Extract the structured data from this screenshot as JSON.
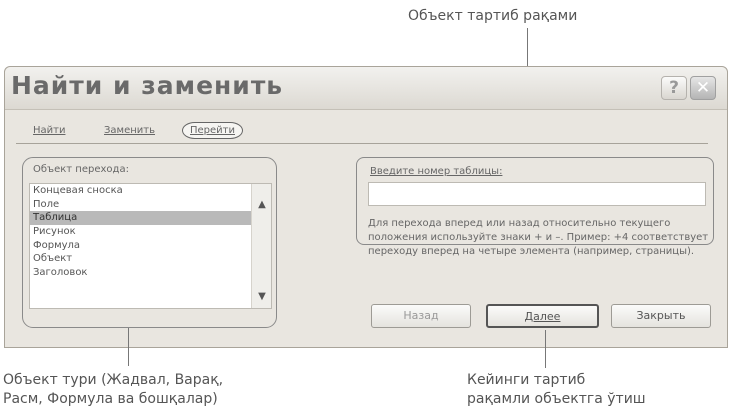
{
  "callouts": {
    "top": "Объект тартиб рақами",
    "left_line1": "Объект тури (Жадвал, Варақ,",
    "left_line2": "Расм, Формула ва бошқалар)",
    "right_line1": "Кейинги тартиб",
    "right_line2": "рақамли объектга ўтиш"
  },
  "dialog": {
    "title": "Найти и заменить",
    "help_label": "?",
    "close_label": "✕",
    "tabs": [
      "Найти",
      "Заменить",
      "Перейти"
    ],
    "object_label": "Объект перехода:",
    "list_items": [
      "Концевая сноска",
      "Поле",
      "Таблица",
      "Рисунок",
      "Формула",
      "Объект",
      "Заголовок"
    ],
    "selected_item": "Таблица",
    "input_label": "Введите номер таблицы:",
    "input_value": "",
    "help_text": "Для перехода вперед или назад относительно текущего положения используйте знаки + и –. Пример: +4 соответствует переходу вперед на четыре элемента (например, страницы).",
    "buttons": {
      "back": "Назад",
      "next": "Далее",
      "close": "Закрыть"
    }
  }
}
